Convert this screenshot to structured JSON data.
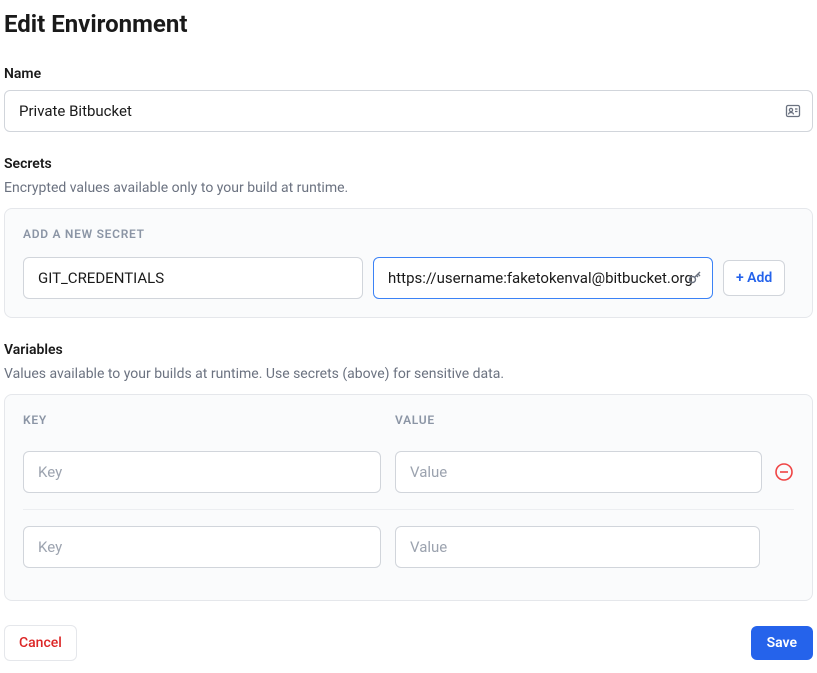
{
  "page_title": "Edit Environment",
  "name_section": {
    "label": "Name",
    "value": "Private Bitbucket"
  },
  "secrets_section": {
    "label": "Secrets",
    "description": "Encrypted values available only to your build at runtime.",
    "panel_title": "ADD A NEW SECRET",
    "key_value": "GIT_CREDENTIALS",
    "value_value": "https://username:faketokenval@bitbucket.org",
    "add_button": "+ Add"
  },
  "variables_section": {
    "label": "Variables",
    "description": "Values available to your builds at runtime. Use secrets (above) for sensitive data.",
    "key_header": "KEY",
    "value_header": "VALUE",
    "key_placeholder": "Key",
    "value_placeholder": "Value"
  },
  "footer": {
    "cancel": "Cancel",
    "save": "Save"
  }
}
